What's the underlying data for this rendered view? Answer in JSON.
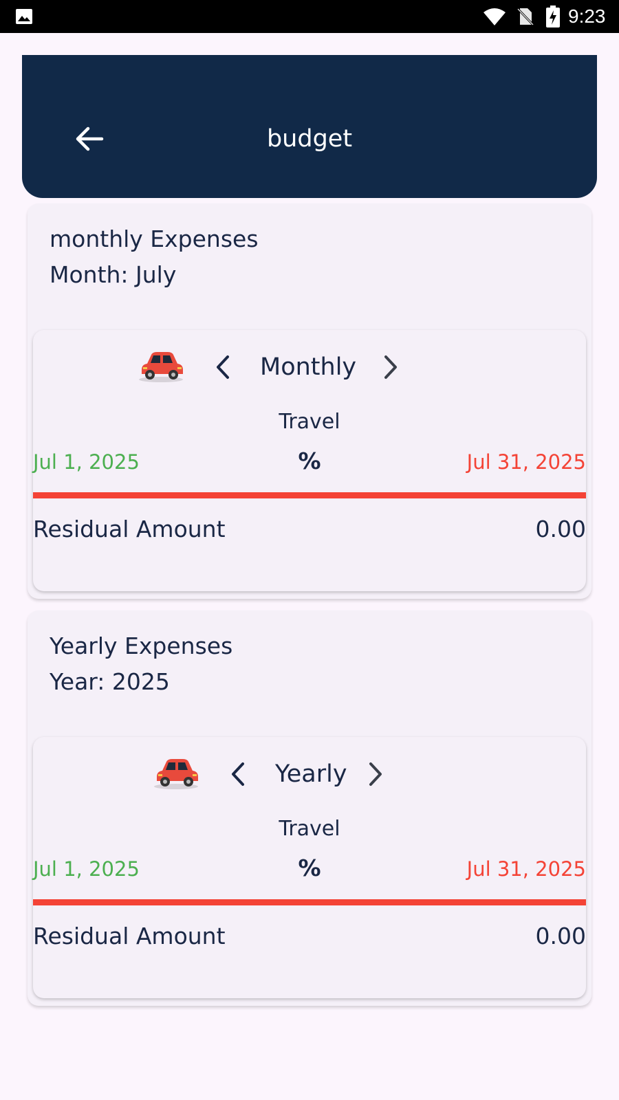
{
  "status_bar": {
    "time": "9:23",
    "icons": [
      "gallery-icon",
      "wifi-icon",
      "no-sim-icon",
      "battery-charging-icon"
    ]
  },
  "header": {
    "title": "budget",
    "back_icon": "arrow-left-icon"
  },
  "colors": {
    "header_bg": "#112948",
    "start_date": "#4caf50",
    "end_date": "#f44336",
    "progress_bar": "#f44336",
    "text": "#1a2745"
  },
  "sections": [
    {
      "title": "monthly Expenses",
      "subtitle": "Month: July",
      "card": {
        "icon": "car-icon",
        "period": "Monthly",
        "category": "Travel",
        "start_date": "Jul 1, 2025",
        "percent": "%",
        "end_date": "Jul 31, 2025",
        "progress_fraction": 1.0,
        "residual_label": "Residual Amount",
        "residual_value": "0.00"
      }
    },
    {
      "title": "Yearly Expenses",
      "subtitle": "Year: 2025",
      "card": {
        "icon": "car-icon",
        "period": "Yearly",
        "category": "Travel",
        "start_date": "Jul 1, 2025",
        "percent": "%",
        "end_date": "Jul 31, 2025",
        "progress_fraction": 1.0,
        "residual_label": "Residual Amount",
        "residual_value": "0.00"
      }
    }
  ]
}
